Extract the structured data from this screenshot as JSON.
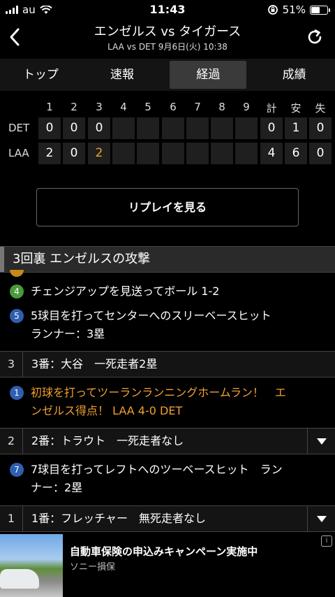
{
  "status": {
    "carrier": "au",
    "time": "11:43",
    "battery": "51%"
  },
  "header": {
    "title": "エンゼルス vs タイガース",
    "subtitle": "LAA vs DET 9月6日(火) 10:38"
  },
  "tabs": [
    {
      "label": "トップ"
    },
    {
      "label": "速報"
    },
    {
      "label": "経過",
      "active": true
    },
    {
      "label": "成績"
    }
  ],
  "scoreboard": {
    "innings": [
      "1",
      "2",
      "3",
      "4",
      "5",
      "6",
      "7",
      "8",
      "9"
    ],
    "totals_headers": [
      "計",
      "安",
      "失"
    ],
    "teams": [
      {
        "name": "DET",
        "scores": [
          "0",
          "0",
          "0",
          "",
          "",
          "",
          "",
          "",
          ""
        ],
        "totals": [
          "0",
          "1",
          "0"
        ]
      },
      {
        "name": "LAA",
        "scores": [
          "2",
          "0",
          "2",
          "",
          "",
          "",
          "",
          "",
          ""
        ],
        "totals": [
          "4",
          "6",
          "0"
        ]
      }
    ]
  },
  "replay_button": "リプレイを見る",
  "section_title": "3回裏 エンゼルスの攻撃",
  "events": [
    {
      "badge": "4",
      "text": "チェンジアップを見送ってボール 1-2"
    },
    {
      "badge": "5",
      "text": "5球目を打ってセンターへのスリーベースヒット",
      "text2": "ランナー：3塁"
    },
    {
      "badge": "1",
      "text": "初球を打ってツーランランニングホームラン！　エ",
      "text2": "ンゼルス得点！ LAA 4-0 DET"
    },
    {
      "badge": "7",
      "text": "7球目を打ってレフトへのツーベースヒット　ラン",
      "text2": "ナー：2塁"
    }
  ],
  "batters": [
    {
      "num": "3",
      "label": "3番：大谷　一死走者2塁"
    },
    {
      "num": "2",
      "label": "2番：トラウト　一死走者なし"
    },
    {
      "num": "1",
      "label": "1番：フレッチャー　無死走者なし"
    }
  ],
  "ad": {
    "title": "自動車保険の申込みキャンペーン実施中",
    "sponsor": "ソニー損保",
    "info": "i"
  },
  "colors": {
    "accent_orange": "#f0a030",
    "badge_green": "#4a9a3a",
    "badge_blue": "#2f5fb0"
  }
}
